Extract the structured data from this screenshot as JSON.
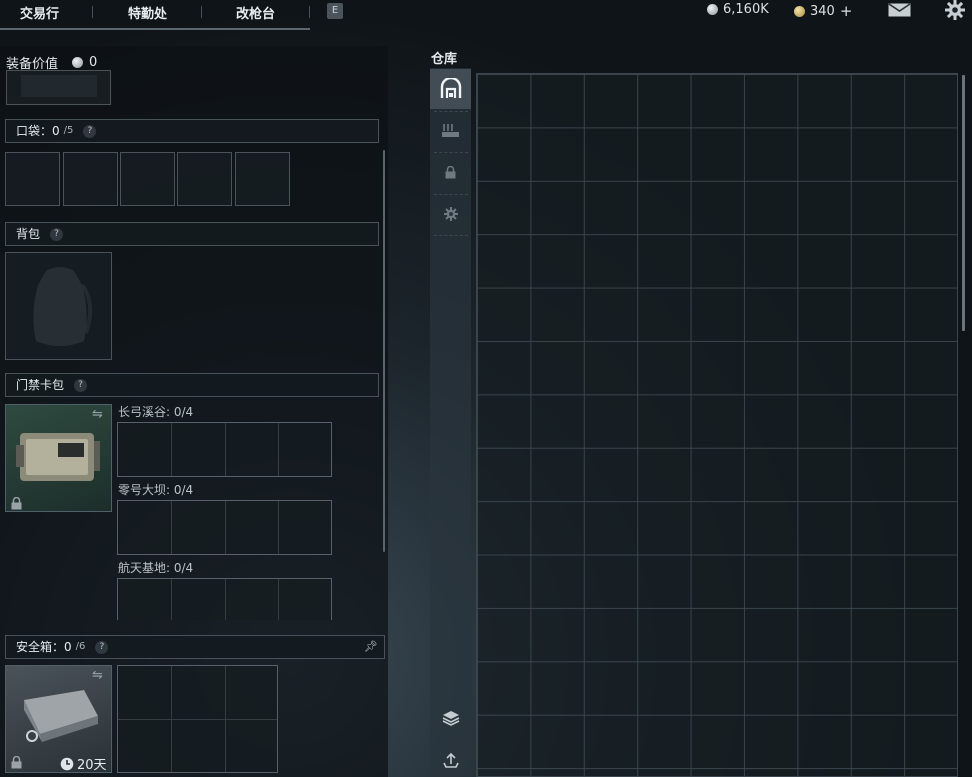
{
  "topnav": {
    "tabs": [
      "交易行",
      "特勤处",
      "改枪台"
    ],
    "hotkey": "E",
    "currency_silver": "6,160K",
    "currency_gold": "340",
    "add_symbol": "+"
  },
  "equipment": {
    "value_label": "装备价值",
    "value": "0"
  },
  "pockets": {
    "label": "口袋：",
    "count": "0",
    "capacity": "/5",
    "help": "?"
  },
  "backpack": {
    "label": "背包",
    "help": "?"
  },
  "keycard": {
    "label": "门禁卡包",
    "help": "?",
    "maps": [
      {
        "name": "长弓溪谷: 0/4"
      },
      {
        "name": "零号大坝: 0/4"
      },
      {
        "name": "航天基地: 0/4"
      }
    ]
  },
  "safebox": {
    "label": "安全箱：",
    "count": "0",
    "capacity": "/6",
    "help": "?",
    "duration": "20天"
  },
  "warehouse": {
    "title": "仓库"
  },
  "colors": {
    "accent": "#e6ecef",
    "panel_bg": "#0c1115",
    "grid_line": "#3c4850"
  }
}
